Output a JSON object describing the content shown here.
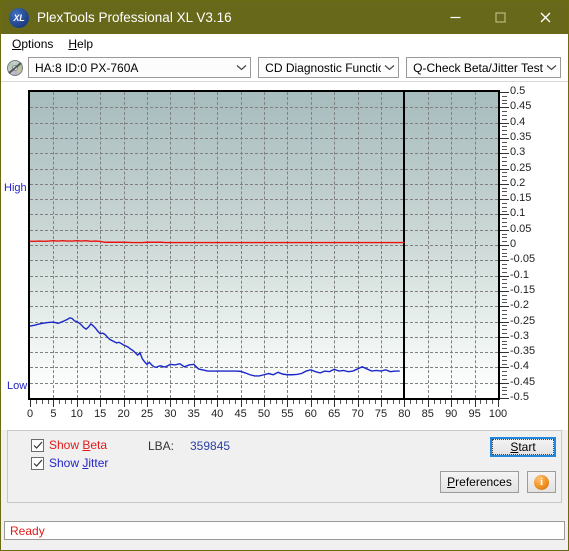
{
  "window": {
    "title": "PlexTools Professional XL V3.16",
    "icon": "XL",
    "icon_name": "plextools-xl-logo-icon",
    "titlebar_color": "#67681a",
    "controls": {
      "minimize": "minimize-icon",
      "maximize": "maximize-icon",
      "close": "close-icon"
    }
  },
  "menubar": {
    "items": [
      {
        "label": "Options",
        "accel": "O"
      },
      {
        "label": "Help",
        "accel": "H"
      }
    ]
  },
  "toolbar": {
    "drive_icon": "optical-disc-icon",
    "drive_select": {
      "value": "HA:8 ID:0  PX-760A",
      "options": [
        "HA:8 ID:0  PX-760A"
      ]
    },
    "function_select": {
      "value": "CD Diagnostic Functions",
      "options": [
        "CD Diagnostic Functions"
      ]
    },
    "test_select": {
      "value": "Q-Check Beta/Jitter Test",
      "options": [
        "Q-Check Beta/Jitter Test"
      ]
    }
  },
  "controls_panel": {
    "show_beta": {
      "label_pre": "Show ",
      "label_accel": "B",
      "label_post": "eta",
      "checked": true,
      "color": "#e01b1b"
    },
    "show_jitter": {
      "label_pre": "Show ",
      "label_accel": "J",
      "label_post": "itter",
      "checked": true,
      "color": "#2424c8"
    },
    "lba_label": "LBA:",
    "lba_value": "359845",
    "start_button": {
      "pre": "",
      "accel": "S",
      "post": "tart"
    },
    "preferences_button": {
      "pre": "",
      "accel": "P",
      "post": "references"
    },
    "info_button": {
      "glyph": "i",
      "name": "info-icon"
    }
  },
  "statusbar": {
    "text": "Ready",
    "color": "#e01b1b"
  },
  "chart_data": {
    "type": "line",
    "title": "Q-Check Beta/Jitter Test",
    "xlabel": "",
    "ylabel": "",
    "xlim": [
      0,
      100
    ],
    "ylim": [
      -0.5,
      0.5
    ],
    "grid": true,
    "legend_position": "none",
    "axis_end_marker_x": 80,
    "y_left_labels": [
      "High",
      "Low"
    ],
    "xticks": [
      0,
      5,
      10,
      15,
      20,
      25,
      30,
      35,
      40,
      45,
      50,
      55,
      60,
      65,
      70,
      75,
      80,
      85,
      90,
      95,
      100
    ],
    "yticks": [
      0.5,
      0.45,
      0.4,
      0.35,
      0.3,
      0.25,
      0.2,
      0.15,
      0.1,
      0.05,
      0,
      -0.05,
      -0.1,
      -0.15,
      -0.2,
      -0.25,
      -0.3,
      -0.35,
      -0.4,
      -0.45,
      -0.5
    ],
    "series": [
      {
        "name": "Beta",
        "color": "#e8130f",
        "x": [
          0,
          1,
          2,
          3,
          4,
          5,
          6,
          7,
          8,
          9,
          10,
          11,
          12,
          13,
          14,
          15,
          16,
          17,
          18,
          19,
          20,
          22,
          24,
          25,
          26,
          27,
          28,
          29,
          30,
          32,
          34,
          36,
          38,
          40,
          45,
          50,
          55,
          60,
          65,
          70,
          75,
          80
        ],
        "values": [
          0.012,
          0.012,
          0.013,
          0.012,
          0.013,
          0.014,
          0.013,
          0.014,
          0.013,
          0.013,
          0.014,
          0.013,
          0.014,
          0.012,
          0.013,
          0.012,
          0.009,
          0.009,
          0.009,
          0.009,
          0.009,
          0.008,
          0.008,
          0.009,
          0.009,
          0.009,
          0.009,
          0.008,
          0.008,
          0.008,
          0.008,
          0.008,
          0.008,
          0.008,
          0.008,
          0.008,
          0.008,
          0.008,
          0.008,
          0.008,
          0.008,
          0.008
        ]
      },
      {
        "name": "Jitter",
        "color": "#1a28c8",
        "x": [
          0,
          1,
          2,
          3,
          4,
          5,
          6,
          7,
          8,
          8.5,
          9,
          9.5,
          10,
          10.5,
          11,
          11.5,
          12,
          12.5,
          13,
          13.5,
          14,
          14.5,
          15,
          15.5,
          16,
          16.5,
          17,
          17.5,
          18,
          18.5,
          19,
          19.5,
          20,
          20.5,
          21,
          21.5,
          22,
          22.5,
          23,
          23.5,
          24,
          24.5,
          25,
          25.5,
          26,
          26.5,
          27,
          27.5,
          28,
          28.5,
          29,
          30,
          31,
          32,
          33,
          34,
          35,
          36,
          38,
          40,
          42,
          44,
          45,
          46,
          47,
          48,
          49,
          50,
          51,
          52,
          53,
          54,
          55,
          56,
          57,
          58,
          59,
          60,
          61,
          62,
          63,
          64,
          65,
          66,
          67,
          68,
          69,
          70,
          71,
          72,
          73,
          74,
          75,
          76,
          77,
          78,
          79,
          80
        ],
        "values": [
          -0.265,
          -0.262,
          -0.258,
          -0.255,
          -0.253,
          -0.252,
          -0.256,
          -0.25,
          -0.243,
          -0.238,
          -0.24,
          -0.248,
          -0.25,
          -0.255,
          -0.262,
          -0.27,
          -0.275,
          -0.268,
          -0.258,
          -0.264,
          -0.272,
          -0.282,
          -0.29,
          -0.288,
          -0.292,
          -0.3,
          -0.308,
          -0.312,
          -0.316,
          -0.32,
          -0.318,
          -0.322,
          -0.327,
          -0.33,
          -0.334,
          -0.34,
          -0.345,
          -0.352,
          -0.36,
          -0.352,
          -0.372,
          -0.382,
          -0.39,
          -0.383,
          -0.392,
          -0.398,
          -0.4,
          -0.396,
          -0.395,
          -0.398,
          -0.398,
          -0.39,
          -0.392,
          -0.388,
          -0.398,
          -0.392,
          -0.39,
          -0.405,
          -0.412,
          -0.412,
          -0.412,
          -0.412,
          -0.413,
          -0.418,
          -0.424,
          -0.428,
          -0.428,
          -0.424,
          -0.42,
          -0.424,
          -0.416,
          -0.422,
          -0.424,
          -0.424,
          -0.423,
          -0.42,
          -0.412,
          -0.408,
          -0.414,
          -0.418,
          -0.412,
          -0.414,
          -0.406,
          -0.412,
          -0.41,
          -0.414,
          -0.412,
          -0.405,
          -0.398,
          -0.405,
          -0.412,
          -0.41,
          -0.412,
          -0.408,
          -0.414,
          -0.412,
          -0.412
        ]
      }
    ]
  }
}
